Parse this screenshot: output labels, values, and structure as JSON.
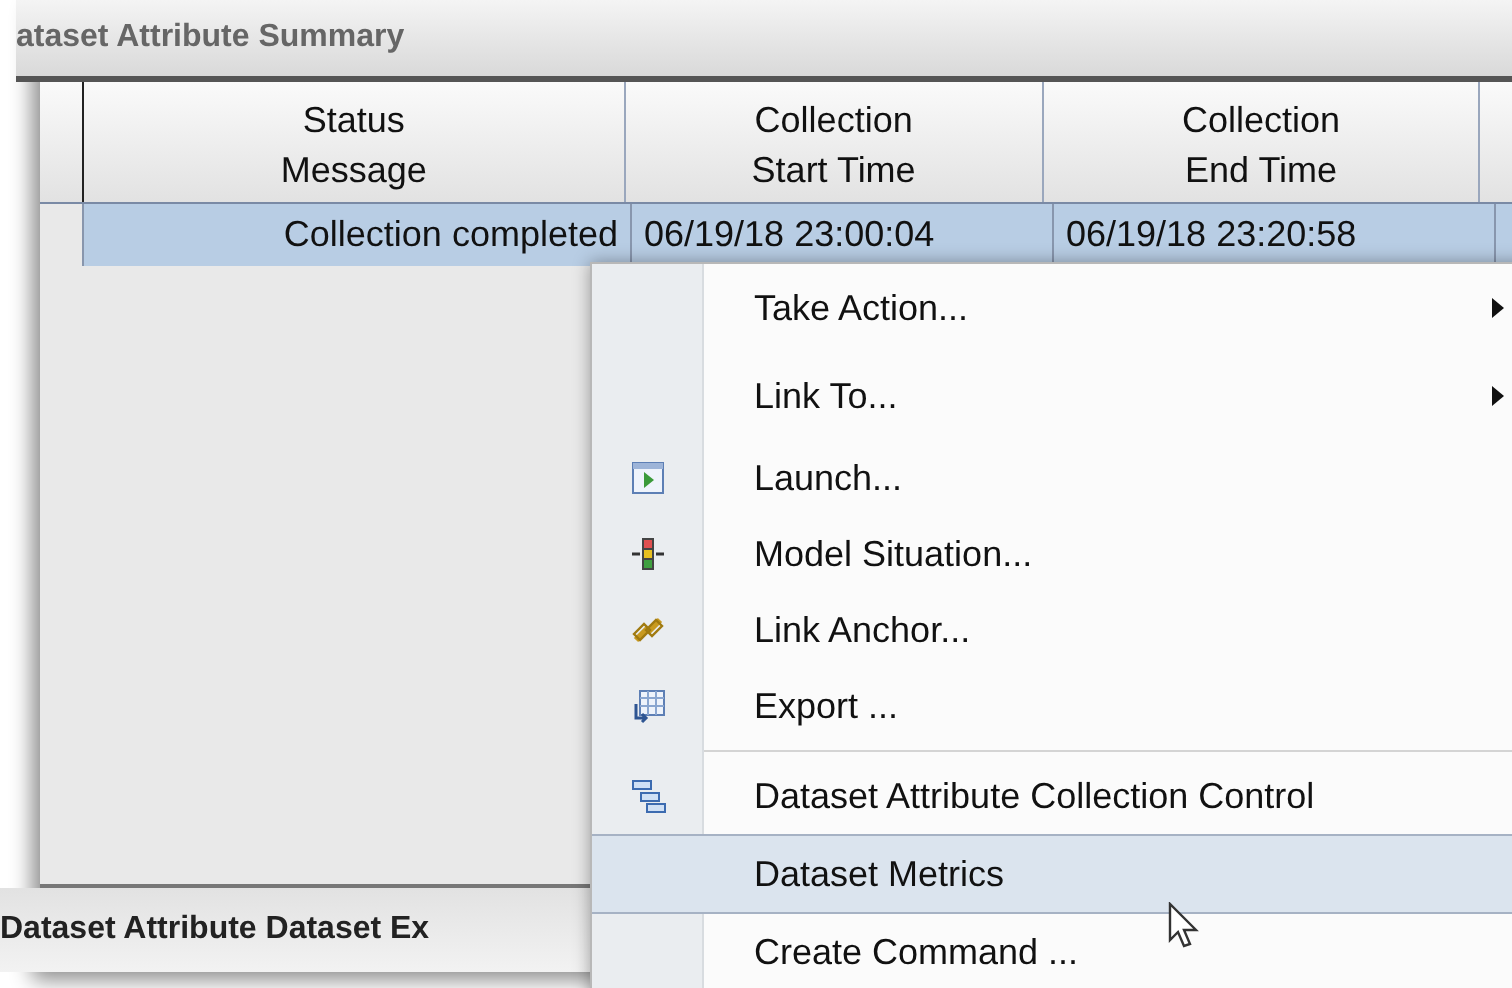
{
  "window": {
    "title": "ataset Attribute Summary"
  },
  "table": {
    "columns": [
      {
        "label": "Status\nMessage"
      },
      {
        "label": "Collection\nStart Time"
      },
      {
        "label": "Collection\nEnd Time"
      },
      {}
    ],
    "rows": [
      {
        "selected": true,
        "cells": [
          "Collection completed",
          "06/19/18 23:00:04",
          "06/19/18 23:20:58"
        ]
      }
    ]
  },
  "bottom_panel": {
    "title": "Dataset Attribute Dataset Ex"
  },
  "context_menu": {
    "items": [
      {
        "kind": "item",
        "label": "Take Action...",
        "submenu": true,
        "selected": false
      },
      {
        "kind": "item",
        "label": "Link To...",
        "submenu": true,
        "selected": false
      },
      {
        "kind": "item",
        "label": "Launch...",
        "selected": false
      },
      {
        "kind": "item",
        "label": "Model Situation...",
        "selected": false
      },
      {
        "kind": "item",
        "label": "Link Anchor...",
        "selected": false
      },
      {
        "kind": "item",
        "label": "Export ...",
        "selected": false
      },
      {
        "kind": "separator"
      },
      {
        "kind": "item",
        "label": "Dataset Attribute Collection Control",
        "selected": false
      },
      {
        "kind": "item",
        "label": "Dataset Metrics",
        "selected": true
      },
      {
        "kind": "item",
        "label": "Create Command ...",
        "selected": false
      }
    ]
  }
}
